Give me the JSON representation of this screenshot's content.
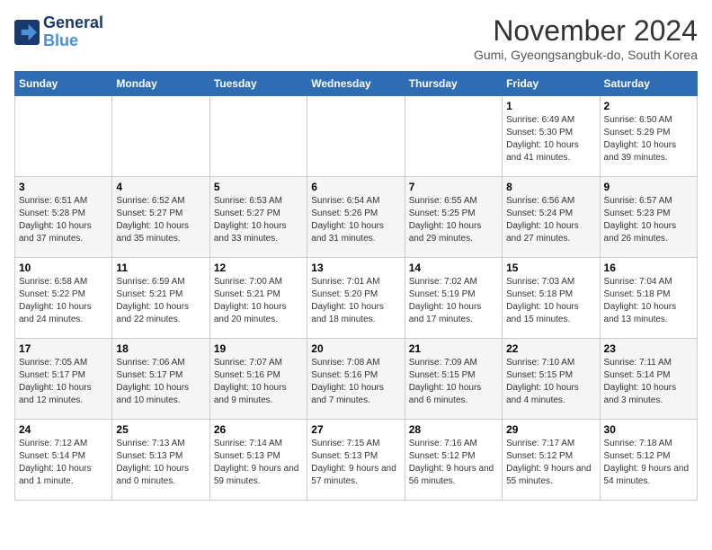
{
  "header": {
    "logo_line1": "General",
    "logo_line2": "Blue",
    "title": "November 2024",
    "location": "Gumi, Gyeongsangbuk-do, South Korea"
  },
  "weekdays": [
    "Sunday",
    "Monday",
    "Tuesday",
    "Wednesday",
    "Thursday",
    "Friday",
    "Saturday"
  ],
  "weeks": [
    [
      {
        "day": "",
        "info": ""
      },
      {
        "day": "",
        "info": ""
      },
      {
        "day": "",
        "info": ""
      },
      {
        "day": "",
        "info": ""
      },
      {
        "day": "",
        "info": ""
      },
      {
        "day": "1",
        "info": "Sunrise: 6:49 AM\nSunset: 5:30 PM\nDaylight: 10 hours and 41 minutes."
      },
      {
        "day": "2",
        "info": "Sunrise: 6:50 AM\nSunset: 5:29 PM\nDaylight: 10 hours and 39 minutes."
      }
    ],
    [
      {
        "day": "3",
        "info": "Sunrise: 6:51 AM\nSunset: 5:28 PM\nDaylight: 10 hours and 37 minutes."
      },
      {
        "day": "4",
        "info": "Sunrise: 6:52 AM\nSunset: 5:27 PM\nDaylight: 10 hours and 35 minutes."
      },
      {
        "day": "5",
        "info": "Sunrise: 6:53 AM\nSunset: 5:27 PM\nDaylight: 10 hours and 33 minutes."
      },
      {
        "day": "6",
        "info": "Sunrise: 6:54 AM\nSunset: 5:26 PM\nDaylight: 10 hours and 31 minutes."
      },
      {
        "day": "7",
        "info": "Sunrise: 6:55 AM\nSunset: 5:25 PM\nDaylight: 10 hours and 29 minutes."
      },
      {
        "day": "8",
        "info": "Sunrise: 6:56 AM\nSunset: 5:24 PM\nDaylight: 10 hours and 27 minutes."
      },
      {
        "day": "9",
        "info": "Sunrise: 6:57 AM\nSunset: 5:23 PM\nDaylight: 10 hours and 26 minutes."
      }
    ],
    [
      {
        "day": "10",
        "info": "Sunrise: 6:58 AM\nSunset: 5:22 PM\nDaylight: 10 hours and 24 minutes."
      },
      {
        "day": "11",
        "info": "Sunrise: 6:59 AM\nSunset: 5:21 PM\nDaylight: 10 hours and 22 minutes."
      },
      {
        "day": "12",
        "info": "Sunrise: 7:00 AM\nSunset: 5:21 PM\nDaylight: 10 hours and 20 minutes."
      },
      {
        "day": "13",
        "info": "Sunrise: 7:01 AM\nSunset: 5:20 PM\nDaylight: 10 hours and 18 minutes."
      },
      {
        "day": "14",
        "info": "Sunrise: 7:02 AM\nSunset: 5:19 PM\nDaylight: 10 hours and 17 minutes."
      },
      {
        "day": "15",
        "info": "Sunrise: 7:03 AM\nSunset: 5:18 PM\nDaylight: 10 hours and 15 minutes."
      },
      {
        "day": "16",
        "info": "Sunrise: 7:04 AM\nSunset: 5:18 PM\nDaylight: 10 hours and 13 minutes."
      }
    ],
    [
      {
        "day": "17",
        "info": "Sunrise: 7:05 AM\nSunset: 5:17 PM\nDaylight: 10 hours and 12 minutes."
      },
      {
        "day": "18",
        "info": "Sunrise: 7:06 AM\nSunset: 5:17 PM\nDaylight: 10 hours and 10 minutes."
      },
      {
        "day": "19",
        "info": "Sunrise: 7:07 AM\nSunset: 5:16 PM\nDaylight: 10 hours and 9 minutes."
      },
      {
        "day": "20",
        "info": "Sunrise: 7:08 AM\nSunset: 5:16 PM\nDaylight: 10 hours and 7 minutes."
      },
      {
        "day": "21",
        "info": "Sunrise: 7:09 AM\nSunset: 5:15 PM\nDaylight: 10 hours and 6 minutes."
      },
      {
        "day": "22",
        "info": "Sunrise: 7:10 AM\nSunset: 5:15 PM\nDaylight: 10 hours and 4 minutes."
      },
      {
        "day": "23",
        "info": "Sunrise: 7:11 AM\nSunset: 5:14 PM\nDaylight: 10 hours and 3 minutes."
      }
    ],
    [
      {
        "day": "24",
        "info": "Sunrise: 7:12 AM\nSunset: 5:14 PM\nDaylight: 10 hours and 1 minute."
      },
      {
        "day": "25",
        "info": "Sunrise: 7:13 AM\nSunset: 5:13 PM\nDaylight: 10 hours and 0 minutes."
      },
      {
        "day": "26",
        "info": "Sunrise: 7:14 AM\nSunset: 5:13 PM\nDaylight: 9 hours and 59 minutes."
      },
      {
        "day": "27",
        "info": "Sunrise: 7:15 AM\nSunset: 5:13 PM\nDaylight: 9 hours and 57 minutes."
      },
      {
        "day": "28",
        "info": "Sunrise: 7:16 AM\nSunset: 5:12 PM\nDaylight: 9 hours and 56 minutes."
      },
      {
        "day": "29",
        "info": "Sunrise: 7:17 AM\nSunset: 5:12 PM\nDaylight: 9 hours and 55 minutes."
      },
      {
        "day": "30",
        "info": "Sunrise: 7:18 AM\nSunset: 5:12 PM\nDaylight: 9 hours and 54 minutes."
      }
    ]
  ]
}
